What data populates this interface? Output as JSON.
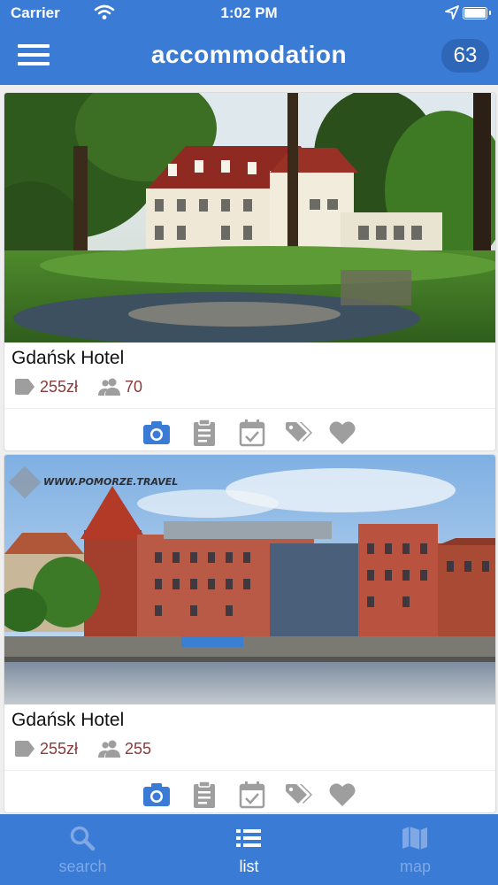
{
  "status_bar": {
    "carrier": "Carrier",
    "time": "1:02 PM"
  },
  "header": {
    "title": "accommodation",
    "count": "63"
  },
  "colors": {
    "primary": "#3a7bd5",
    "price": "#8b3a3a",
    "camera_active": "#3a7bd5",
    "icon_gray": "#9e9e9e"
  },
  "cards": [
    {
      "name": "Gdańsk Hotel",
      "price": "255zł",
      "capacity": "70"
    },
    {
      "name": "Gdańsk Hotel",
      "price": "255zł",
      "capacity": "255",
      "photo_watermark": "WWW.POMORZE.TRAVEL"
    }
  ],
  "card_actions": [
    "camera-icon",
    "clipboard-icon",
    "calendar-check-icon",
    "tags-icon",
    "heart-icon"
  ],
  "tabs": [
    {
      "label": "search",
      "icon": "search-icon",
      "active": false
    },
    {
      "label": "list",
      "icon": "list-icon",
      "active": true
    },
    {
      "label": "map",
      "icon": "map-icon",
      "active": false
    }
  ]
}
